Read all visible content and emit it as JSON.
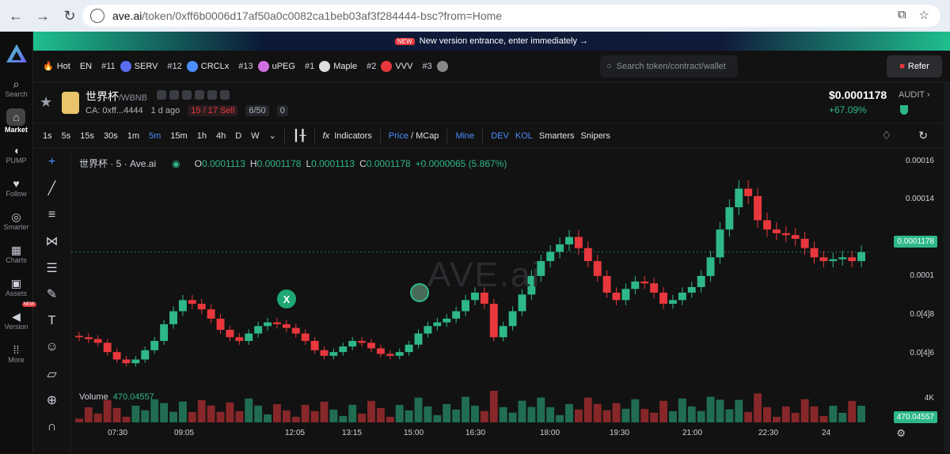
{
  "browser": {
    "url_host": "ave.ai",
    "url_path": "/token/0xff6b0006d17af50a0c0082ca1beb03af3f284444-bsc?from=Home"
  },
  "sidebar": {
    "items": [
      {
        "label": "Search",
        "icon": "search-icon"
      },
      {
        "label": "Market",
        "icon": "market-icon"
      },
      {
        "label": "PUMP",
        "icon": "pill-icon"
      },
      {
        "label": "Follow",
        "icon": "heart-icon"
      },
      {
        "label": "Smarter",
        "icon": "compass-icon"
      },
      {
        "label": "Charts",
        "icon": "table-icon"
      },
      {
        "label": "Assets",
        "icon": "wallet-icon"
      },
      {
        "label": "Version",
        "icon": "version-icon",
        "badge": "NEW"
      },
      {
        "label": "More",
        "icon": "grid-icon"
      }
    ]
  },
  "banner": {
    "badge": "NEW",
    "text": "New version entrance, enter immediately →"
  },
  "hotbar": {
    "hot_label": "Hot",
    "lang": "EN",
    "items": [
      {
        "rank": "#11",
        "name": "SERV",
        "color": "#5a6cf0"
      },
      {
        "rank": "#12",
        "name": "CRCLx",
        "color": "#4c8dff"
      },
      {
        "rank": "#13",
        "name": "uPEG",
        "color": "#d070e0"
      },
      {
        "rank": "#1",
        "name": "Maple",
        "color": "#ddd"
      },
      {
        "rank": "#2",
        "name": "VVV",
        "color": "#e8383d"
      },
      {
        "rank": "#3",
        "name": "",
        "color": "#888"
      }
    ],
    "search_placeholder": "Search token/contract/wallet",
    "refer_label": "Refer"
  },
  "token": {
    "name": "世界杯",
    "pair": "/WBNB",
    "ca": "CA: 0xff...4444",
    "age": "1 d ago",
    "sells": "15 / 17 Sell",
    "holders": "6/50",
    "count": "0",
    "price": "$0.0001178",
    "change": "+67.09%",
    "audit": "AUDIT"
  },
  "toolbar": {
    "timeframes": [
      "1s",
      "5s",
      "15s",
      "30s",
      "1m",
      "5m",
      "15m",
      "1h",
      "4h",
      "D",
      "W"
    ],
    "selected": "5m",
    "indicators": "Indicators",
    "price_label": "Price",
    "mcap_label": "/ MCap",
    "mine": "Mine",
    "dev": "DEV",
    "kol": "KOL",
    "smarters": "Smarters",
    "snipers": "Snipers"
  },
  "chart": {
    "title": "世界杯 · 5 · Ave.ai",
    "o": "0.0001113",
    "h": "0.0001178",
    "l": "0.0001113",
    "c": "0.0001178",
    "delta": "+0.0000065 (5.867%)",
    "volume_label": "Volume",
    "volume_value": "470.04557",
    "watermark": "AVE.ai",
    "y_labels": [
      "0.00016",
      "0.00014",
      "0.0001",
      "0.0[4]8",
      "0.0[4]6"
    ],
    "price_tag": "0.0001178",
    "vol_axis": "4K",
    "vol_tag": "470.04557",
    "x_labels": [
      "07:30",
      "09:05",
      "12:05",
      "13:15",
      "15:00",
      "16:30",
      "18:00",
      "19:30",
      "21:00",
      "22:30",
      "24"
    ],
    "up_color": "#2eb887",
    "down_color": "#e8383d"
  },
  "chart_data": {
    "type": "candlestick",
    "closes": [
      7.2e-05,
      7.1e-05,
      6.9e-05,
      6.4e-05,
      6e-05,
      5.8e-05,
      6e-05,
      6.5e-05,
      7e-05,
      7.9e-05,
      8.6e-05,
      9.2e-05,
      9e-05,
      8.7e-05,
      8.2e-05,
      7.6e-05,
      7.2e-05,
      7e-05,
      7.4e-05,
      7.8e-05,
      8e-05,
      7.9e-05,
      7.7e-05,
      7.4e-05,
      7e-05,
      6.5e-05,
      6.2e-05,
      6.4e-05,
      6.7e-05,
      7e-05,
      6.9e-05,
      6.6e-05,
      6.3e-05,
      6.2e-05,
      6.4e-05,
      6.8e-05,
      7.4e-05,
      7.8e-05,
      8e-05,
      8.2e-05,
      8.6e-05,
      9.2e-05,
      9.6e-05,
      9e-05,
      7.2e-05,
      7.8e-05,
      8.6e-05,
      9.5e-05,
      0.000105,
      0.000113,
      0.000118,
      0.000122,
      0.000126,
      0.00012,
      0.000113,
      0.000105,
      9.6e-05,
      9.2e-05,
      9.8e-05,
      0.000102,
      0.000101,
      9.6e-05,
      9e-05,
      9.2e-05,
      9.6e-05,
      9.9e-05,
      0.000105,
      0.000115,
      0.00013,
      0.000142,
      0.000152,
      0.000148,
      0.000135,
      0.00013,
      0.000128,
      0.000127,
      0.000125,
      0.00012,
      0.000115,
      0.000113,
      0.000114,
      0.000115,
      0.000113,
      0.0001178
    ],
    "volume_max": 4000
  }
}
